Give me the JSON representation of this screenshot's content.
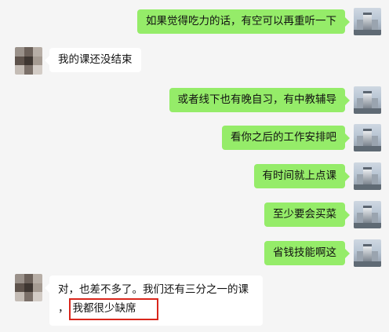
{
  "messages": [
    {
      "side": "right",
      "text": "如果觉得吃力的话，有空可以再重听一下"
    },
    {
      "side": "left",
      "text": "我的课还没结束"
    },
    {
      "side": "right",
      "text": "或者线下也有晚自习，有中教辅导"
    },
    {
      "side": "right",
      "text": "看你之后的工作安排吧"
    },
    {
      "side": "right",
      "text": "有时间就上点课"
    },
    {
      "side": "right",
      "text": "至少要会买菜"
    },
    {
      "side": "right",
      "text": "省钱技能啊这"
    },
    {
      "side": "left",
      "line1": "对，也差不多了。我们还有三分之一的课",
      "line2_prefix": "，",
      "line2_highlight": "我都很少缺席"
    }
  ],
  "colors": {
    "background": "#f5f5f5",
    "self_bubble": "#95ec69",
    "other_bubble": "#ffffff",
    "highlight_border": "#d9261c"
  },
  "icons": {
    "self_avatar": "building-avatar-icon",
    "other_avatar": "pixelated-avatar-icon"
  }
}
